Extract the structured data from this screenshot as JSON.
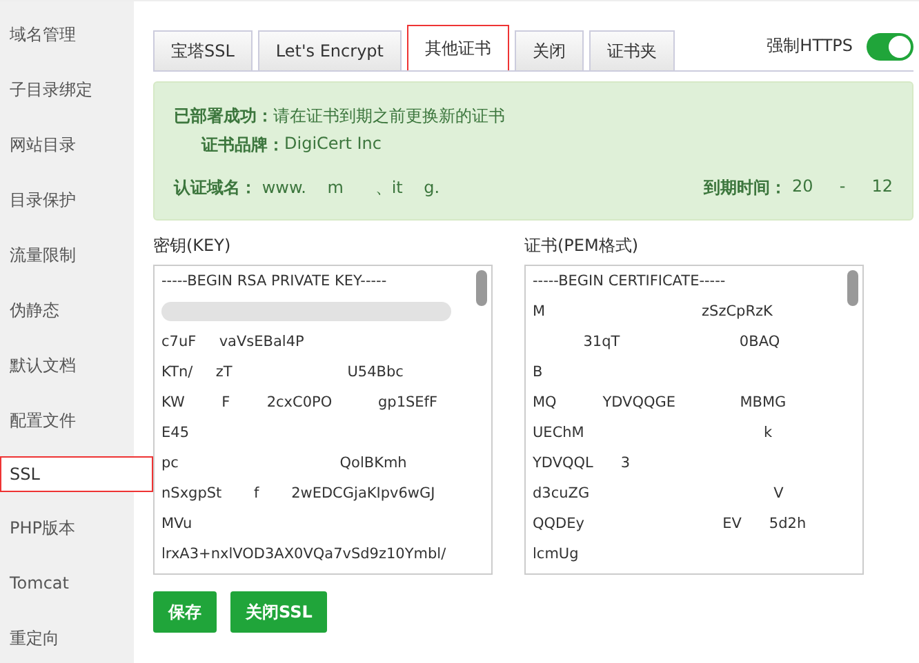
{
  "sidebar": {
    "items": [
      {
        "label": "域名管理",
        "selected": false
      },
      {
        "label": "子目录绑定",
        "selected": false
      },
      {
        "label": "网站目录",
        "selected": false
      },
      {
        "label": "目录保护",
        "selected": false
      },
      {
        "label": "流量限制",
        "selected": false
      },
      {
        "label": "伪静态",
        "selected": false
      },
      {
        "label": "默认文档",
        "selected": false
      },
      {
        "label": "配置文件",
        "selected": false
      },
      {
        "label": "SSL",
        "selected": true
      },
      {
        "label": "PHP版本",
        "selected": false
      },
      {
        "label": "Tomcat",
        "selected": false
      },
      {
        "label": "重定向",
        "selected": false
      }
    ]
  },
  "tabs": [
    {
      "label": "宝塔SSL",
      "selected": false
    },
    {
      "label": "Let's Encrypt",
      "selected": false
    },
    {
      "label": "其他证书",
      "selected": true
    },
    {
      "label": "关闭",
      "selected": false
    },
    {
      "label": "证书夹",
      "selected": false
    }
  ],
  "force_https": {
    "label": "强制HTTPS",
    "on": true
  },
  "alert": {
    "status_label": "已部署成功：",
    "status_text": "请在证书到期之前更换新的证书",
    "brand_label": "证书品牌：",
    "brand": "DigiCert Inc",
    "domain_label": "认证域名：",
    "domain": "www.    m      、it    g.",
    "expiry_label": "到期时间：",
    "expiry": "20     -     12"
  },
  "key": {
    "label": "密钥(KEY)",
    "lines": [
      "-----BEGIN RSA PRIVATE KEY-----",
      {
        "kind": "redacted"
      },
      "c7uF     vaVsEBal4P",
      "KTn/     zT                         U54Bbc",
      "KW        F        2cxC0PO          gp1SEfF",
      "E45",
      "pc                                   QolBKmh",
      "nSxgpSt       f       2wEDCGjaKIpv6wGJ",
      "MVu",
      "lrxA3+nxlVOD3AX0VQa7vSd9z10Ymbl/"
    ]
  },
  "cert": {
    "label": "证书(PEM格式)",
    "lines": [
      "-----BEGIN CERTIFICATE-----",
      "M                                  zSzCpRzK",
      "           31qT                          0BAQ",
      "B",
      "MQ          YDVQQGE              MBMG",
      "UEChM                                       k",
      "YDVQQL      3",
      "d3cuZG                                        V",
      "QQDEy                              EV      5d2h",
      "lcmUg"
    ]
  },
  "buttons": [
    {
      "label": "保存"
    },
    {
      "label": "关闭SSL"
    }
  ]
}
